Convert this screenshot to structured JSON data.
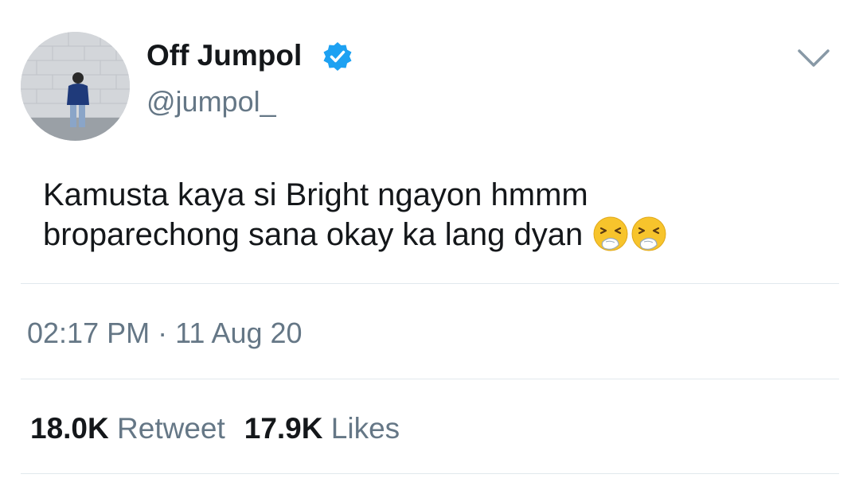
{
  "tweet": {
    "author": {
      "display_name": "Off Jumpol",
      "handle": "@jumpol_",
      "verified_icon": "verified-badge-icon",
      "avatar": "profile-photo"
    },
    "menu_icon": "chevron-down-icon",
    "text_lines": [
      "Kamusta kaya si Bright ngayon hmmm",
      "broparechong sana okay ka lang dyan"
    ],
    "emojis": [
      "sneezing-face-emoji",
      "sneezing-face-emoji"
    ],
    "timestamp": "02:17 PM · 11 Aug 20",
    "stats": {
      "retweets_count": "18.0K",
      "retweets_label": "Retweet",
      "likes_count": "17.9K",
      "likes_label": "Likes"
    }
  },
  "colors": {
    "text_primary": "#14171a",
    "text_secondary": "#657786",
    "verified_blue": "#1da1f2",
    "divider": "#e1e8ed"
  }
}
